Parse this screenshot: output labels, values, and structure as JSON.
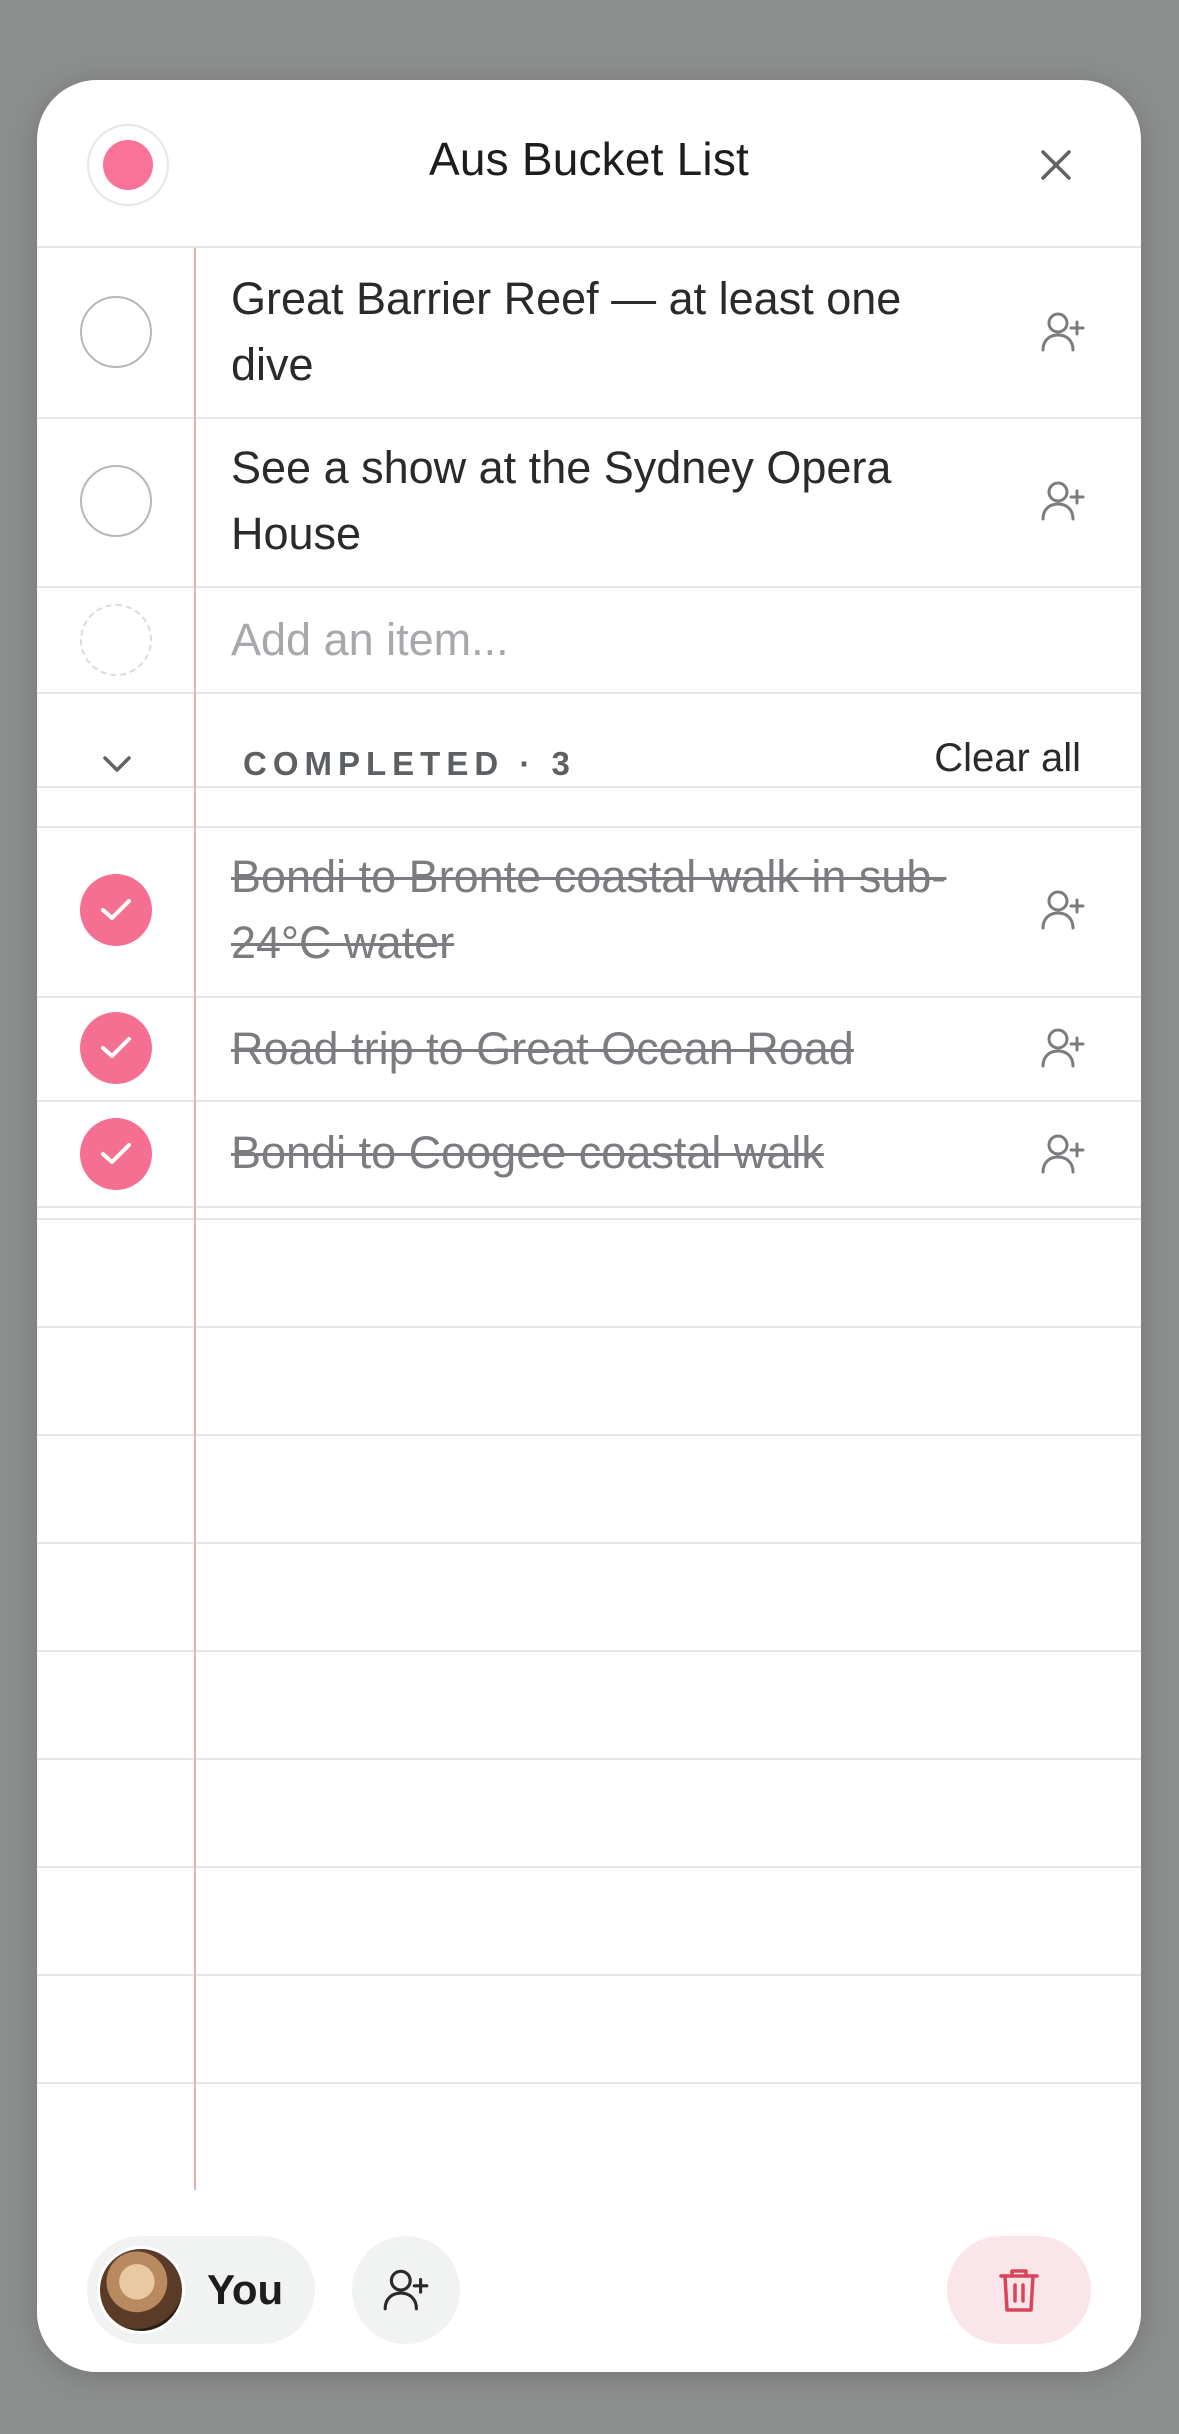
{
  "header": {
    "title": "Aus Bucket List",
    "list_color": "#f87397",
    "close_icon": "close-icon"
  },
  "active_items": [
    {
      "text": "Great Barrier Reef — at least one dive",
      "done": false
    },
    {
      "text": "See a show at the Sydney Opera House",
      "done": false
    }
  ],
  "add_item": {
    "placeholder": "Add an item..."
  },
  "completed": {
    "label": "COMPLETED · 3",
    "clear_all_label": "Clear all",
    "items": [
      {
        "text": "Bondi to Bronte coastal walk in sub-24°C water",
        "done": true
      },
      {
        "text": "Road trip to Great Ocean Road",
        "done": true
      },
      {
        "text": "Bondi to Coogee coastal walk",
        "done": true
      }
    ]
  },
  "footer": {
    "you_label": "You",
    "add_person_icon": "add-person-icon",
    "delete_icon": "trash-icon"
  },
  "colors": {
    "accent": "#f56f93",
    "margin_line": "#e7b1b1",
    "delete_bg": "#fae6e8",
    "delete_icon": "#d9455b"
  }
}
